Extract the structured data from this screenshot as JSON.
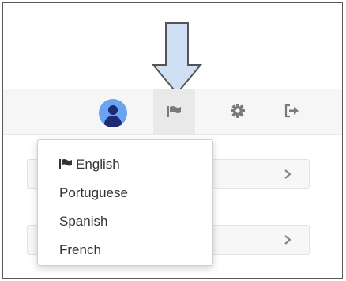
{
  "colors": {
    "callout_fill": "#cfe0f5",
    "callout_stroke": "#555555",
    "avatar_bg": "#6aa3ef",
    "avatar_fg": "#1d2a74",
    "icon_gray": "#7a7a7a",
    "text": "#333333"
  },
  "toolbar": {
    "icons": [
      "user-avatar",
      "flag-icon",
      "gear-icon",
      "logout-icon"
    ]
  },
  "language_menu": {
    "items": [
      {
        "label": "English",
        "icon": "flag-icon",
        "selected": true
      },
      {
        "label": "Portuguese"
      },
      {
        "label": "Spanish"
      },
      {
        "label": "French"
      }
    ]
  }
}
